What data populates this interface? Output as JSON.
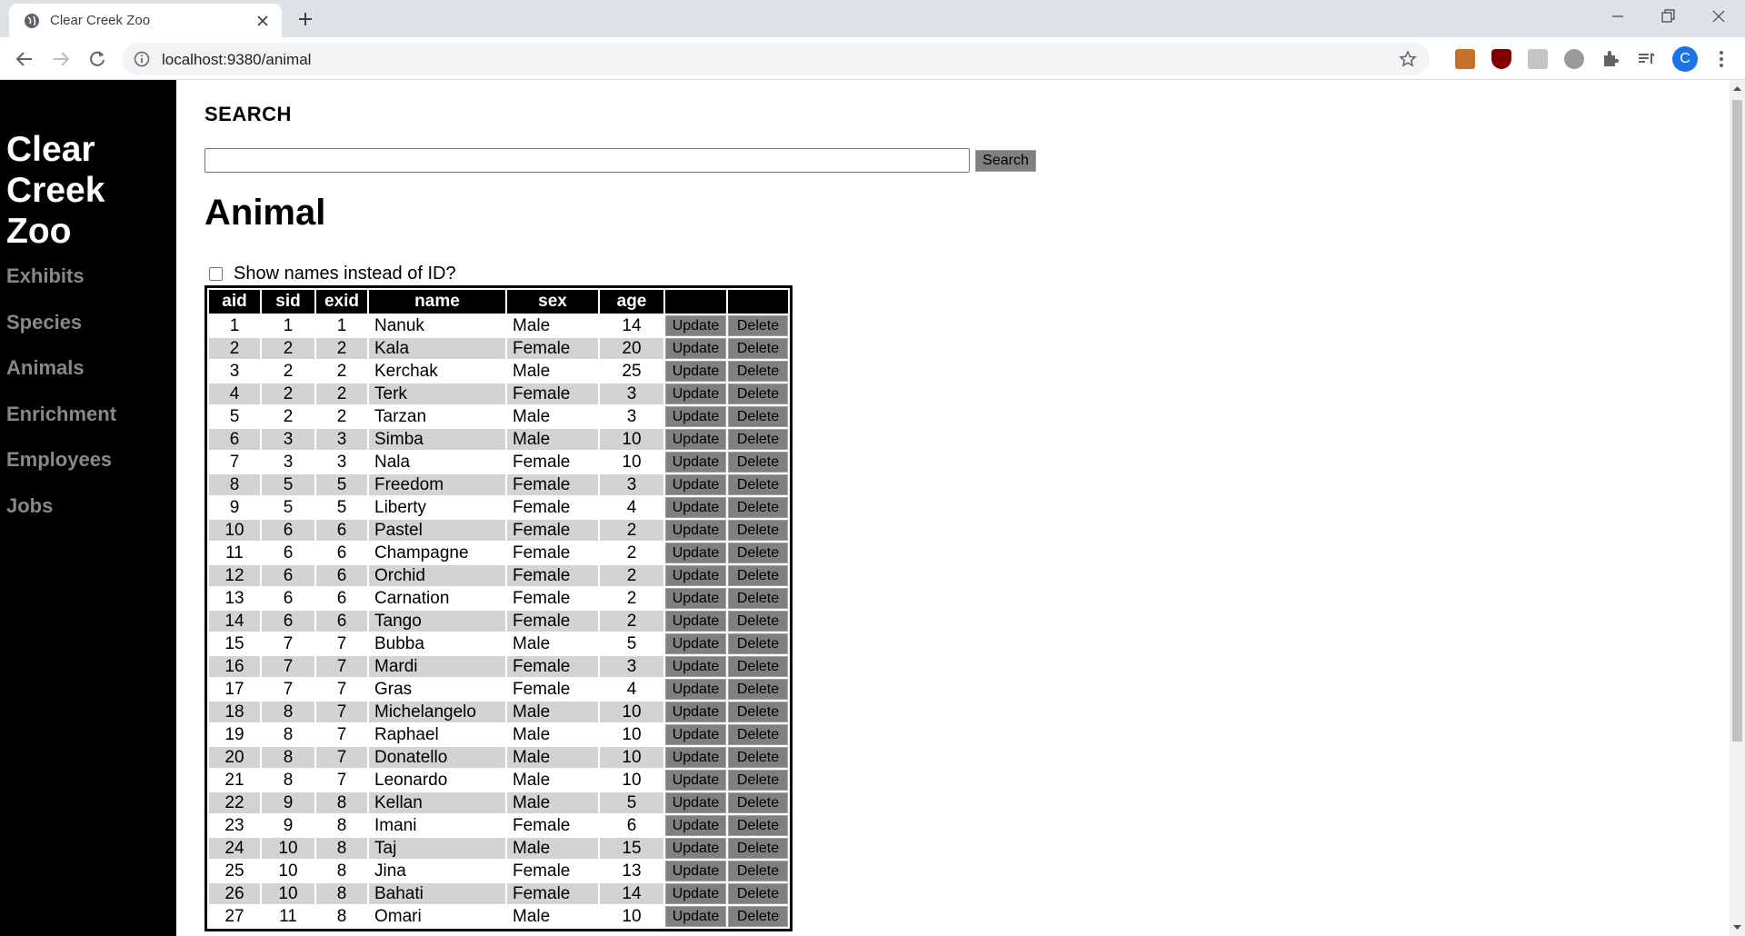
{
  "browser": {
    "tab_title": "Clear Creek Zoo",
    "url": "localhost:9380/animal",
    "avatar_letter": "C"
  },
  "sidebar": {
    "site_title": "Clear Creek Zoo",
    "nav_items": [
      "Exhibits",
      "Species",
      "Animals",
      "Enrichment",
      "Employees",
      "Jobs"
    ]
  },
  "search": {
    "heading": "SEARCH",
    "value": "",
    "button_label": "Search"
  },
  "page_title": "Animal",
  "toggle_label": "Show names instead of ID?",
  "table": {
    "columns": [
      "aid",
      "sid",
      "exid",
      "name",
      "sex",
      "age"
    ],
    "update_label": "Update",
    "delete_label": "Delete",
    "rows": [
      [
        "1",
        "1",
        "1",
        "Nanuk",
        "Male",
        "14"
      ],
      [
        "2",
        "2",
        "2",
        "Kala",
        "Female",
        "20"
      ],
      [
        "3",
        "2",
        "2",
        "Kerchak",
        "Male",
        "25"
      ],
      [
        "4",
        "2",
        "2",
        "Terk",
        "Female",
        "3"
      ],
      [
        "5",
        "2",
        "2",
        "Tarzan",
        "Male",
        "3"
      ],
      [
        "6",
        "3",
        "3",
        "Simba",
        "Male",
        "10"
      ],
      [
        "7",
        "3",
        "3",
        "Nala",
        "Female",
        "10"
      ],
      [
        "8",
        "5",
        "5",
        "Freedom",
        "Female",
        "3"
      ],
      [
        "9",
        "5",
        "5",
        "Liberty",
        "Female",
        "4"
      ],
      [
        "10",
        "6",
        "6",
        "Pastel",
        "Female",
        "2"
      ],
      [
        "11",
        "6",
        "6",
        "Champagne",
        "Female",
        "2"
      ],
      [
        "12",
        "6",
        "6",
        "Orchid",
        "Female",
        "2"
      ],
      [
        "13",
        "6",
        "6",
        "Carnation",
        "Female",
        "2"
      ],
      [
        "14",
        "6",
        "6",
        "Tango",
        "Female",
        "2"
      ],
      [
        "15",
        "7",
        "7",
        "Bubba",
        "Male",
        "5"
      ],
      [
        "16",
        "7",
        "7",
        "Mardi",
        "Female",
        "3"
      ],
      [
        "17",
        "7",
        "7",
        "Gras",
        "Female",
        "4"
      ],
      [
        "18",
        "8",
        "7",
        "Michelangelo",
        "Male",
        "10"
      ],
      [
        "19",
        "8",
        "7",
        "Raphael",
        "Male",
        "10"
      ],
      [
        "20",
        "8",
        "7",
        "Donatello",
        "Male",
        "10"
      ],
      [
        "21",
        "8",
        "7",
        "Leonardo",
        "Male",
        "10"
      ],
      [
        "22",
        "9",
        "8",
        "Kellan",
        "Male",
        "5"
      ],
      [
        "23",
        "9",
        "8",
        "Imani",
        "Female",
        "6"
      ],
      [
        "24",
        "10",
        "8",
        "Taj",
        "Male",
        "15"
      ],
      [
        "25",
        "10",
        "8",
        "Jina",
        "Female",
        "13"
      ],
      [
        "26",
        "10",
        "8",
        "Bahati",
        "Female",
        "14"
      ],
      [
        "27",
        "11",
        "8",
        "Omari",
        "Male",
        "10"
      ]
    ]
  }
}
